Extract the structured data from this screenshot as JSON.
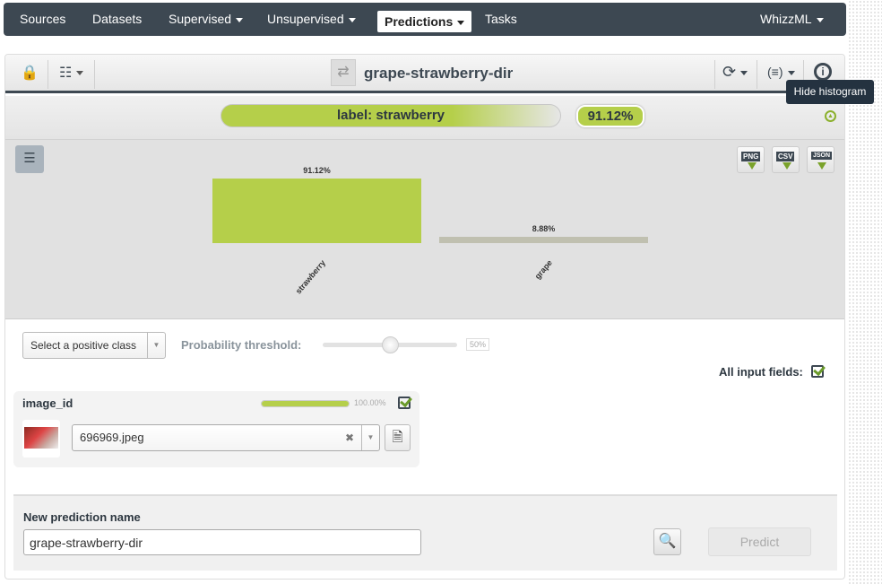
{
  "nav": {
    "items": [
      "Sources",
      "Datasets",
      "Supervised",
      "Unsupervised",
      "Predictions",
      "Tasks"
    ],
    "active": "Predictions",
    "right": "WhizzML"
  },
  "toolbar": {
    "title": "grape-strawberry-dir"
  },
  "prediction": {
    "label": "label: strawberry",
    "confidence": "91.12%"
  },
  "tooltip": "Hide histogram",
  "downloads": [
    "PNG",
    "CSV",
    "JSON"
  ],
  "chart_data": {
    "type": "bar",
    "categories": [
      "strawberry",
      "grape"
    ],
    "values": [
      91.12,
      8.88
    ],
    "data_labels": [
      "91.12%",
      "8.88%"
    ],
    "ylim": [
      0,
      100
    ],
    "colors": [
      "#b5cf4a",
      "#c0c0b0"
    ]
  },
  "controls": {
    "positive_class_placeholder": "Select a positive class",
    "threshold_label": "Probability threshold:",
    "threshold_value": "50%",
    "threshold": 0.5,
    "all_fields_label": "All input fields:"
  },
  "field": {
    "name": "image_id",
    "coverage": "100.00%",
    "coverage_fraction": 1.0,
    "value": "696969.jpeg"
  },
  "form": {
    "name_label": "New prediction name",
    "name_value": "grape-strawberry-dir",
    "predict_label": "Predict"
  }
}
